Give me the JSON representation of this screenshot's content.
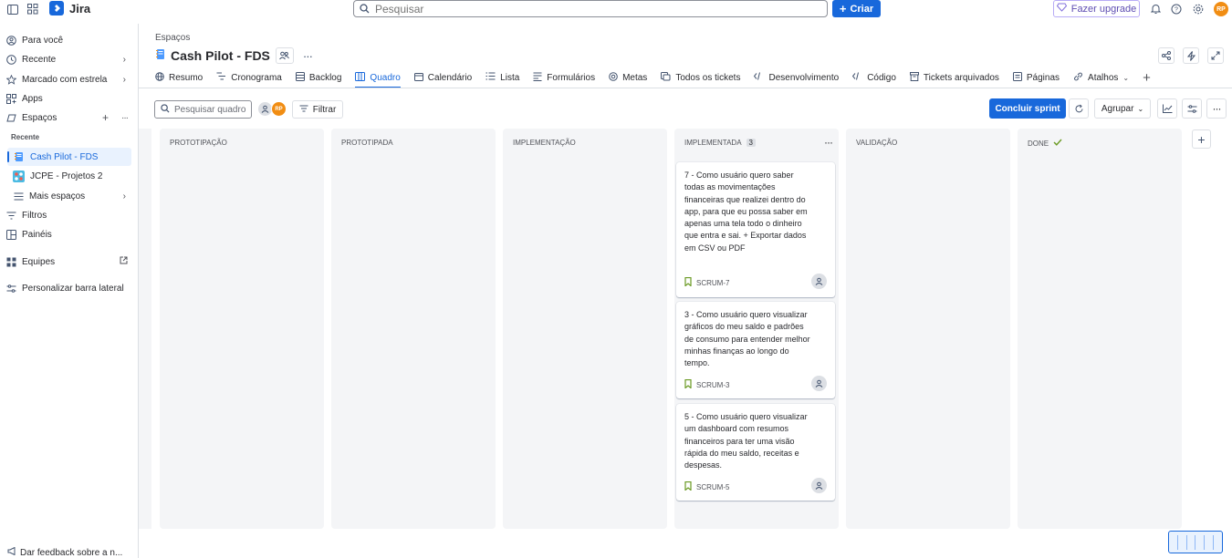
{
  "topbar": {
    "app_name": "Jira",
    "search_placeholder": "Pesquisar",
    "create_label": "Criar",
    "upgrade_label": "Fazer upgrade",
    "user_initials": "RP"
  },
  "sidebar": {
    "items": [
      {
        "label": "Para você",
        "icon": "user-circle-icon"
      },
      {
        "label": "Recente",
        "icon": "clock-icon"
      },
      {
        "label": "Marcado com estrela",
        "icon": "star-icon"
      },
      {
        "label": "Apps",
        "icon": "apps-icon"
      },
      {
        "label": "Espaços",
        "icon": "spaces-icon"
      }
    ],
    "recent_heading": "Recente",
    "spaces": [
      {
        "label": "Cash Pilot - FDS",
        "active": true
      },
      {
        "label": "JCPE - Projetos 2",
        "active": false
      }
    ],
    "more_spaces": "Mais espaços",
    "filters": "Filtros",
    "dashboards": "Painéis",
    "teams": "Equipes",
    "customize": "Personalizar barra lateral",
    "feedback": "Dar feedback sobre a n..."
  },
  "header": {
    "breadcrumb": "Espaços",
    "project_title": "Cash Pilot - FDS"
  },
  "tabs": [
    {
      "label": "Resumo",
      "icon": "globe-icon"
    },
    {
      "label": "Cronograma",
      "icon": "timeline-icon"
    },
    {
      "label": "Backlog",
      "icon": "backlog-icon"
    },
    {
      "label": "Quadro",
      "icon": "board-icon",
      "active": true
    },
    {
      "label": "Calendário",
      "icon": "calendar-icon"
    },
    {
      "label": "Lista",
      "icon": "list-icon"
    },
    {
      "label": "Formulários",
      "icon": "forms-icon"
    },
    {
      "label": "Metas",
      "icon": "goals-icon"
    },
    {
      "label": "Todos os tickets",
      "icon": "tickets-icon"
    },
    {
      "label": "Desenvolvimento",
      "icon": "dev-icon"
    },
    {
      "label": "Código",
      "icon": "code-icon"
    },
    {
      "label": "Tickets arquivados",
      "icon": "archive-icon"
    },
    {
      "label": "Páginas",
      "icon": "pages-icon"
    },
    {
      "label": "Atalhos",
      "icon": "link-icon"
    }
  ],
  "toolbar": {
    "search_placeholder": "Pesquisar quadro",
    "filter_label": "Filtrar",
    "sprint_label": "Concluir sprint",
    "group_label": "Agrupar"
  },
  "columns": [
    {
      "title": "PROTOTIPAÇÃO"
    },
    {
      "title": "PROTOTIPADA"
    },
    {
      "title": "IMPLEMENTAÇÃO"
    },
    {
      "title": "IMPLEMENTADA",
      "count": "3"
    },
    {
      "title": "VALIDAÇÃO"
    },
    {
      "title": "DONE"
    }
  ],
  "cards": [
    {
      "text": "7 - Como usuário quero saber todas as movimentações financeiras que realizei dentro do app, para que eu possa saber em apenas uma tela todo o dinheiro que entra e sai. + Exportar dados em CSV ou PDF",
      "key": "SCRUM-7"
    },
    {
      "text": "3 - Como usuário quero visualizar gráficos do meu saldo e padrões de consumo para entender melhor minhas finanças ao longo do tempo.",
      "key": "SCRUM-3"
    },
    {
      "text": "5 - Como usuário quero visualizar um dashboard com resumos financeiros para ter uma visão rápida do meu saldo, receitas e despesas.",
      "key": "SCRUM-5"
    }
  ],
  "colors": {
    "accent": "#1868db",
    "avatar": "#f18d13",
    "column_bg": "#f4f5f7",
    "story_icon": "#6a9a23"
  }
}
